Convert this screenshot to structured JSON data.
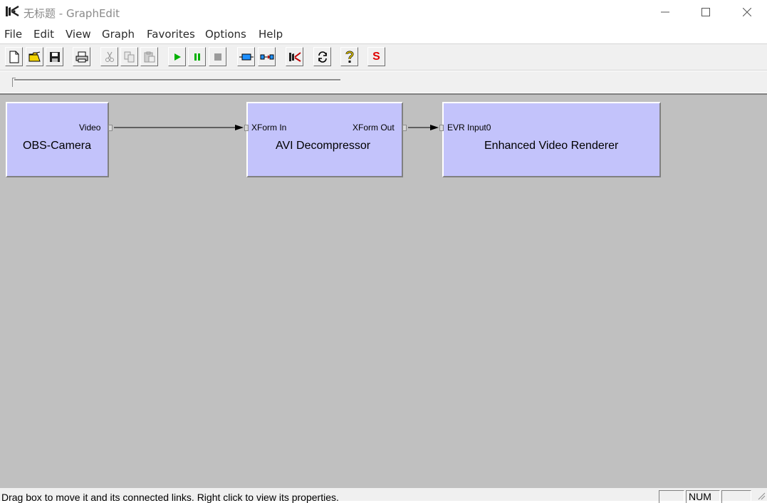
{
  "window": {
    "title": "无标题 - GraphEdit",
    "controls": [
      "minimize",
      "maximize",
      "close"
    ]
  },
  "menu": [
    "File",
    "Edit",
    "View",
    "Graph",
    "Favorites",
    "Options",
    "Help"
  ],
  "toolbar": {
    "buttons": [
      {
        "name": "new-icon",
        "enabled": true
      },
      {
        "name": "open-icon",
        "enabled": true
      },
      {
        "name": "save-icon",
        "enabled": true
      },
      {
        "name": "print-icon",
        "enabled": true
      },
      {
        "name": "cut-icon",
        "enabled": false
      },
      {
        "name": "copy-icon",
        "enabled": false
      },
      {
        "name": "paste-icon",
        "enabled": false
      },
      {
        "name": "play-icon",
        "enabled": true
      },
      {
        "name": "pause-icon",
        "enabled": true
      },
      {
        "name": "stop-icon",
        "enabled": false
      },
      {
        "name": "insert-filter-icon",
        "enabled": true
      },
      {
        "name": "connect-pins-icon",
        "enabled": true
      },
      {
        "name": "graphedit-icon",
        "enabled": true
      },
      {
        "name": "refresh-icon",
        "enabled": true
      },
      {
        "name": "help-icon",
        "enabled": true
      },
      {
        "name": "sync-icon",
        "enabled": true,
        "label": "S"
      }
    ]
  },
  "seek": {
    "position": 0
  },
  "graph": {
    "filters": [
      {
        "id": "obs-camera",
        "name": "OBS-Camera",
        "input_pins": [],
        "output_pins": [
          "Video"
        ]
      },
      {
        "id": "avi-decompressor",
        "name": "AVI Decompressor",
        "input_pins": [
          "XForm In"
        ],
        "output_pins": [
          "XForm Out"
        ]
      },
      {
        "id": "enhanced-video-renderer",
        "name": "Enhanced Video Renderer",
        "input_pins": [
          "EVR Input0"
        ],
        "output_pins": []
      }
    ],
    "connections": [
      {
        "from": "OBS-Camera.Video",
        "to": "AVI Decompressor.XForm In"
      },
      {
        "from": "AVI Decompressor.XForm Out",
        "to": "Enhanced Video Renderer.EVR Input0"
      }
    ]
  },
  "status": {
    "message": "Drag box to move it and its connected links. Right click to view its properties.",
    "panes": [
      "",
      "NUM",
      ""
    ]
  },
  "colors": {
    "filter_fill": "#c3c3fb",
    "canvas": "#c0c0c0",
    "play_green": "#00b000",
    "sync_red": "#e00000"
  }
}
